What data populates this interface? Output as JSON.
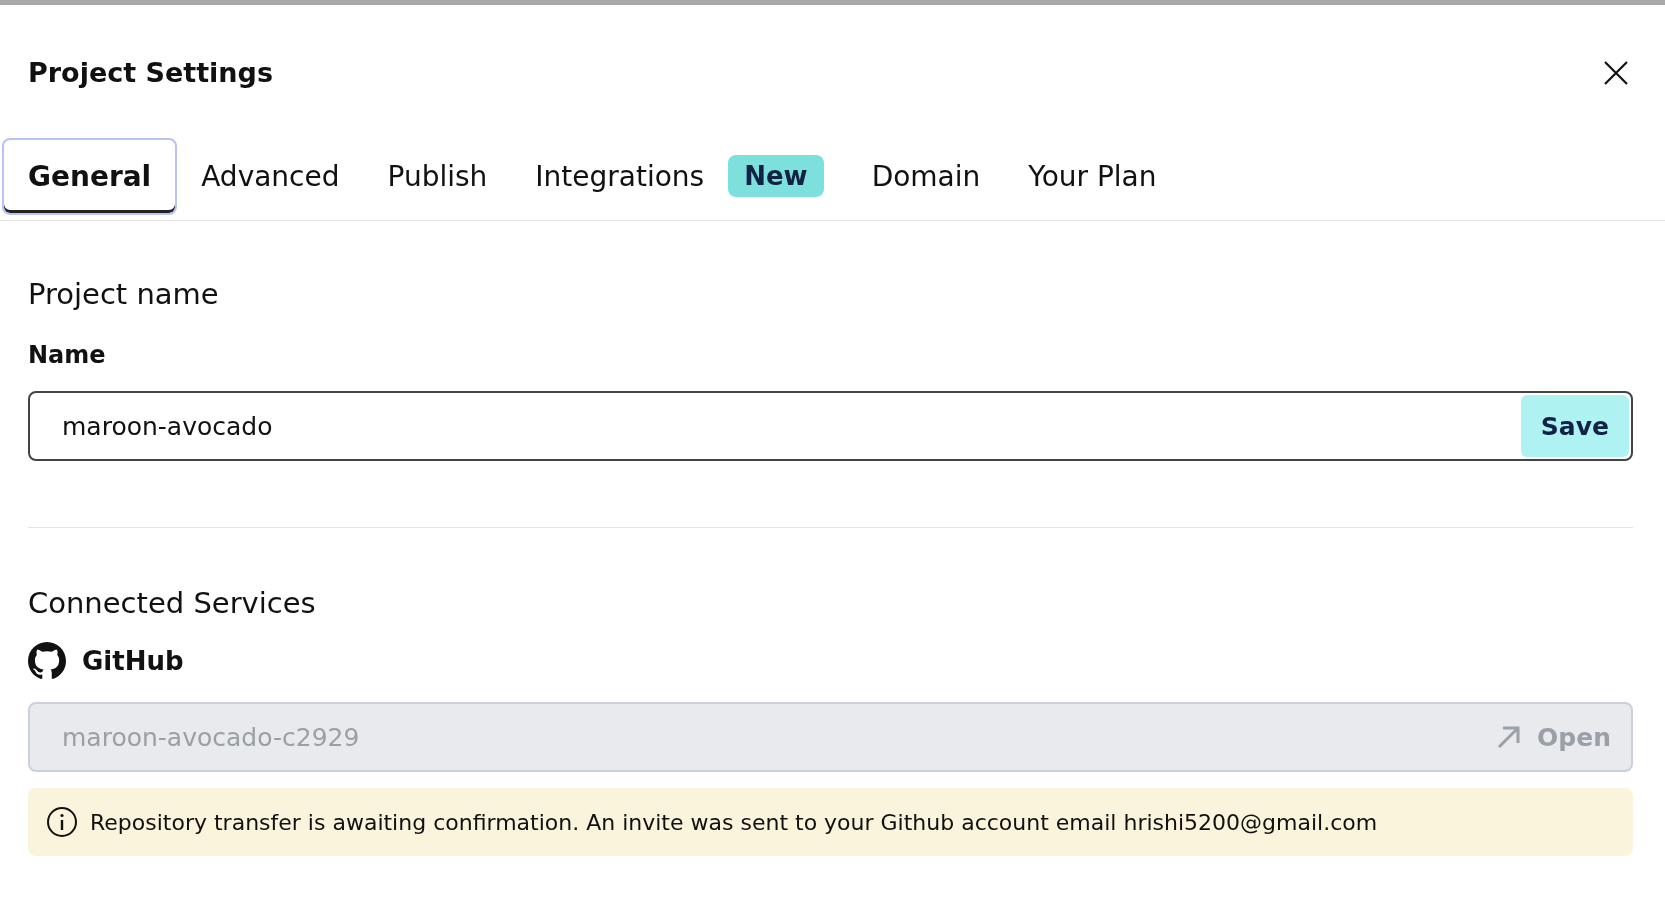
{
  "dialog": {
    "title": "Project Settings"
  },
  "tabs": [
    {
      "label": "General",
      "selected": true
    },
    {
      "label": "Advanced",
      "selected": false
    },
    {
      "label": "Publish",
      "selected": false
    },
    {
      "label": "Integrations",
      "selected": false,
      "badge": "New"
    },
    {
      "label": "Domain",
      "selected": false
    },
    {
      "label": "Your Plan",
      "selected": false
    }
  ],
  "project_name": {
    "heading": "Project name",
    "label": "Name",
    "value": "maroon-avocado",
    "button": "Save"
  },
  "connected_services": {
    "heading": "Connected Services",
    "service": "GitHub",
    "repository": {
      "value": "maroon-avocado-c2929",
      "disabled": true,
      "button": "Open"
    },
    "notice": "Repository transfer is awaiting confirmation. An invite was sent to your Github account email hrishi5200@gmail.com"
  }
}
